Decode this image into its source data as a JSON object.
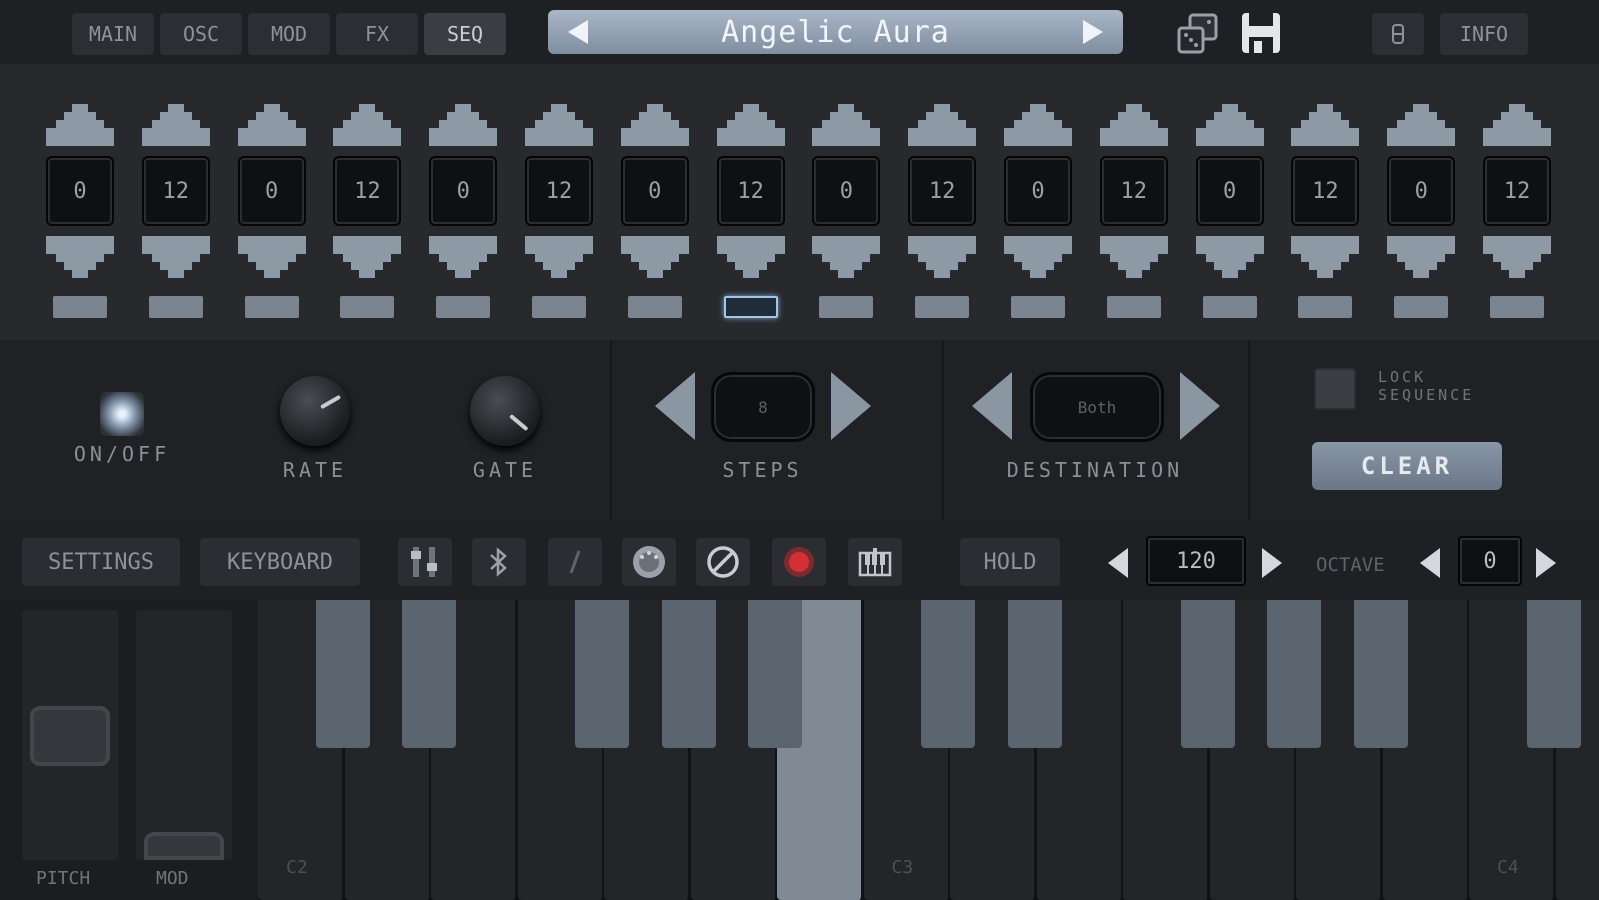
{
  "tabs": [
    {
      "label": "MAIN",
      "active": false
    },
    {
      "label": "OSC",
      "active": false
    },
    {
      "label": "MOD",
      "active": false
    },
    {
      "label": "FX",
      "active": false
    },
    {
      "label": "SEQ",
      "active": true
    }
  ],
  "preset": {
    "name": "Angelic Aura"
  },
  "top_icons": {
    "dice": "dice-icon",
    "save": "save-icon",
    "memory": "memory-icon"
  },
  "info_label": "INFO",
  "sequencer": {
    "steps": [
      {
        "value": "0"
      },
      {
        "value": "12"
      },
      {
        "value": "0"
      },
      {
        "value": "12"
      },
      {
        "value": "0"
      },
      {
        "value": "12"
      },
      {
        "value": "0"
      },
      {
        "value": "12"
      },
      {
        "value": "0"
      },
      {
        "value": "12"
      },
      {
        "value": "0"
      },
      {
        "value": "12"
      },
      {
        "value": "0"
      },
      {
        "value": "12"
      },
      {
        "value": "0"
      },
      {
        "value": "12"
      }
    ],
    "active_step_index": 7
  },
  "controls": {
    "onoff_label": "ON/OFF",
    "rate_label": "RATE",
    "gate_label": "GATE",
    "steps_label": "STEPS",
    "steps_value": "8",
    "destination_label": "DESTINATION",
    "destination_value": "Both",
    "lock_label_1": "LOCK",
    "lock_label_2": "SEQUENCE",
    "clear_label": "CLEAR"
  },
  "kbbar": {
    "settings_label": "SETTINGS",
    "keyboard_label": "KEYBOARD",
    "hold_label": "HOLD",
    "tempo_value": "120",
    "octave_label": "OCTAVE",
    "octave_value": "0",
    "record_color": "#c0282b"
  },
  "wheels": {
    "pitch_label": "PITCH",
    "mod_label": "MOD"
  },
  "keyboard": {
    "labels": [
      "C2",
      "C3",
      "C4"
    ]
  },
  "colors": {
    "accent": "#a7c4e3",
    "preset_bg": "#8d9cad"
  }
}
